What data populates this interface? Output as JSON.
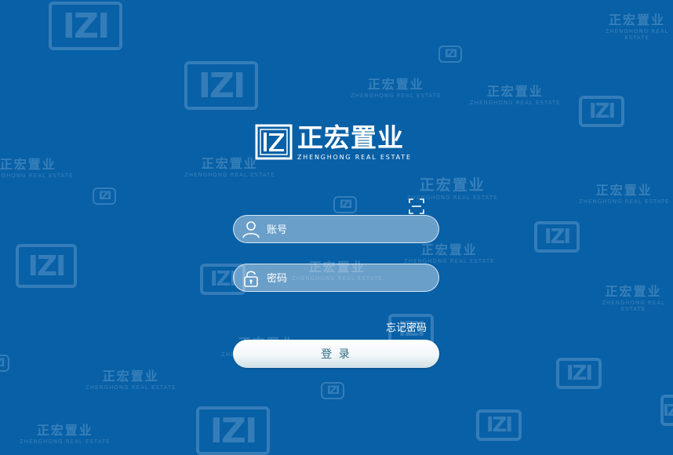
{
  "brand": {
    "name_cn": "正宏置业",
    "name_en": "ZHENGHONG REAL ESTATE"
  },
  "watermark": {
    "logo_glyph": "IZI",
    "name_cn": "正宏置业",
    "name_en": "ZHENGHONG REAL ESTATE"
  },
  "login": {
    "account_placeholder": "账号",
    "password_placeholder": "密码",
    "forgot_label": "忘记密码",
    "submit_label": "登 录"
  },
  "colors": {
    "background": "#0860a6",
    "button_text": "#2f6a86"
  },
  "icons": {
    "scan": "scan-icon",
    "user": "user-icon",
    "lock": "lock-icon"
  }
}
